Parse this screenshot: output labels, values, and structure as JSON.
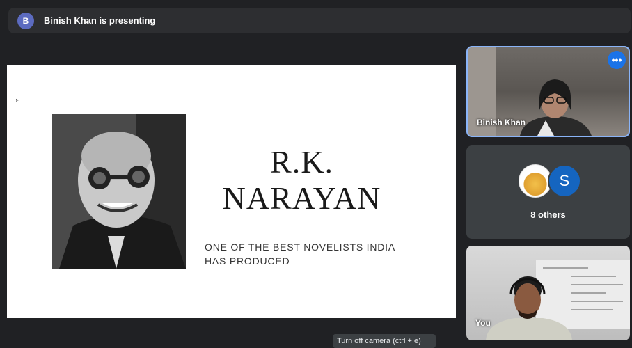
{
  "banner": {
    "avatar_letter": "B",
    "presenting_text": "Binish Khan is presenting"
  },
  "slide": {
    "cursor_glyph": "▹",
    "title_line1": "R.K.",
    "title_line2": "NARAYAN",
    "subtitle_line1": "ONE OF THE BEST NOVELISTS INDIA",
    "subtitle_line2": "HAS PRODUCED"
  },
  "tiles": {
    "presenter_name": "Binish Khan",
    "more_options_glyph": "•••",
    "others_avatar_letter": "S",
    "others_label": "8 others",
    "self_name": "You"
  },
  "tooltip": {
    "text": "Turn off camera (ctrl + e)"
  },
  "colors": {
    "background": "#202124",
    "accent": "#8ab4f8",
    "more_button": "#1a73e8",
    "avatar_s": "#1565c0"
  }
}
